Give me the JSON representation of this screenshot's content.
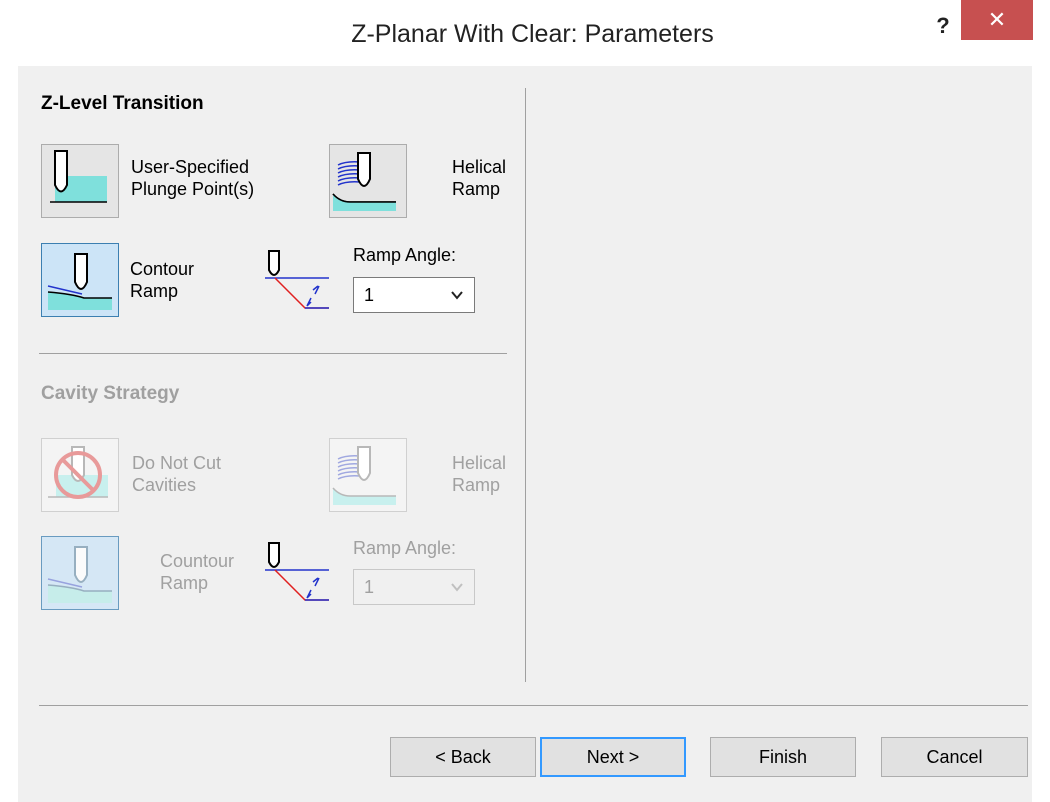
{
  "window": {
    "title": "Z-Planar With Clear: Parameters",
    "help_glyph": "?",
    "close_glyph": "✕"
  },
  "zlevel": {
    "heading": "Z-Level Transition",
    "user_specified": {
      "line1": "User-Specified",
      "line2": "Plunge Point(s)"
    },
    "helical": {
      "line1": "Helical",
      "line2": "Ramp"
    },
    "contour": {
      "line1": "Contour",
      "line2": "Ramp"
    },
    "ramp_angle_label": "Ramp Angle:",
    "ramp_angle_value": "1"
  },
  "cavity": {
    "heading": "Cavity Strategy",
    "do_not_cut": {
      "line1": "Do Not Cut",
      "line2": "Cavities"
    },
    "helical": {
      "line1": "Helical",
      "line2": "Ramp"
    },
    "contour": {
      "line1": "Countour",
      "line2": "Ramp"
    },
    "ramp_angle_label": "Ramp Angle:",
    "ramp_angle_value": "1"
  },
  "buttons": {
    "back": "< Back",
    "next": "Next >",
    "finish": "Finish",
    "cancel": "Cancel"
  },
  "colors": {
    "close": "#c75050",
    "selected": "#cce4f7",
    "default_border": "#3399ff",
    "fill_cyan": "#7fe0dc",
    "tool_blue": "#2233cc",
    "ramp_red": "#e02020"
  }
}
